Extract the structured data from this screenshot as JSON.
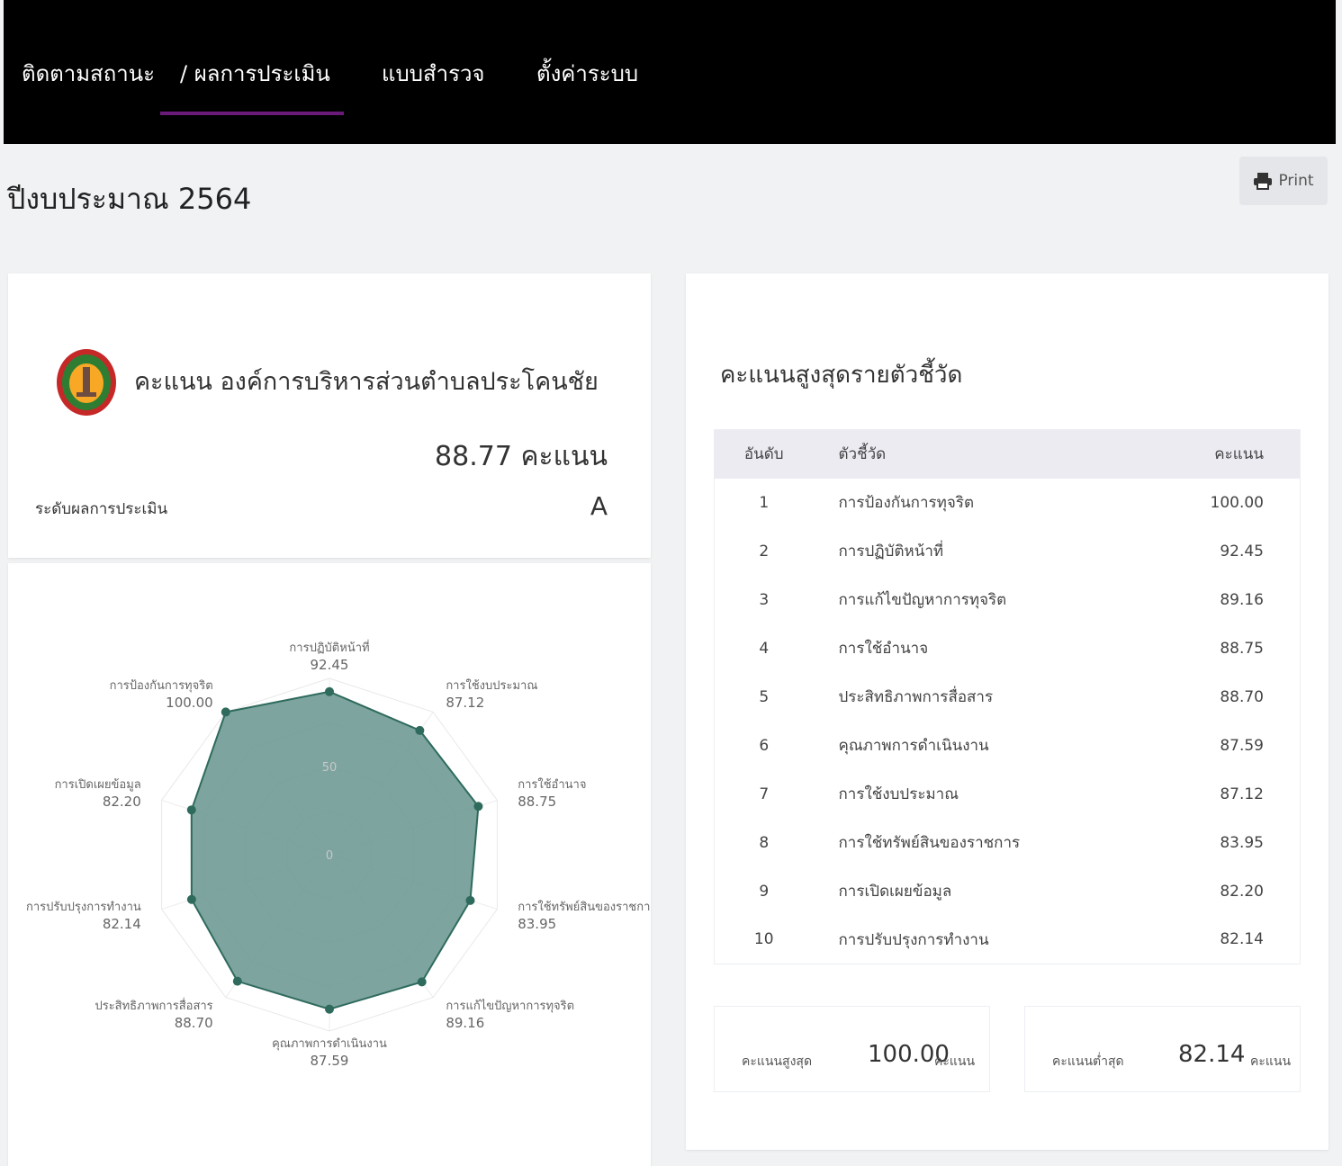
{
  "nav": {
    "items": [
      {
        "label": "ติดตามสถานะ"
      },
      {
        "label": "/ ผลการประเมิน"
      },
      {
        "label": "แบบสำรวจ"
      },
      {
        "label": "ตั้งค่าระบบ"
      }
    ]
  },
  "page": {
    "title": "ปีงบประมาณ 2564",
    "print_label": "Print"
  },
  "summary": {
    "org_title": "คะแนน องค์การบริหารส่วนตำบลประโคนชัย",
    "score_text": "88.77 คะแนน",
    "level_label": "ระดับผลการประเมิน",
    "level_value": "A"
  },
  "ranking": {
    "title": "คะแนนสูงสุดรายตัวชี้วัด",
    "headers": {
      "rank": "อันดับ",
      "indicator": "ตัวชี้วัด",
      "score": "คะแนน"
    },
    "rows": [
      {
        "rank": "1",
        "indicator": "การป้องกันการทุจริต",
        "score": "100.00"
      },
      {
        "rank": "2",
        "indicator": "การปฏิบัติหน้าที่",
        "score": "92.45"
      },
      {
        "rank": "3",
        "indicator": "การแก้ไขปัญหาการทุจริต",
        "score": "89.16"
      },
      {
        "rank": "4",
        "indicator": "การใช้อำนาจ",
        "score": "88.75"
      },
      {
        "rank": "5",
        "indicator": "ประสิทธิภาพการสื่อสาร",
        "score": "88.70"
      },
      {
        "rank": "6",
        "indicator": "คุณภาพการดำเนินงาน",
        "score": "87.59"
      },
      {
        "rank": "7",
        "indicator": "การใช้งบประมาณ",
        "score": "87.12"
      },
      {
        "rank": "8",
        "indicator": "การใช้ทรัพย์สินของราชการ",
        "score": "83.95"
      },
      {
        "rank": "9",
        "indicator": "การเปิดเผยข้อมูล",
        "score": "82.20"
      },
      {
        "rank": "10",
        "indicator": "การปรับปรุงการทำงาน",
        "score": "82.14"
      }
    ],
    "max_label": "คะแนนสูงสุด",
    "max_value": "100.00",
    "max_unit": "คะแนน",
    "min_label": "คะแนนต่ำสุด",
    "min_value": "82.14",
    "min_unit": "คะแนน"
  },
  "colors": {
    "fill": "#6f9a95",
    "stroke": "#2f6b5d",
    "point": "#2f6b5d",
    "accent": "#6a1b7a"
  },
  "chart_data": {
    "type": "radar",
    "range": [
      0,
      100
    ],
    "tick_labels": [
      "0",
      "50"
    ],
    "axes": [
      {
        "label": "การปฏิบัติหน้าที่",
        "value": 92.45,
        "value_label": "92.45"
      },
      {
        "label": "การใช้งบประมาณ",
        "value": 87.12,
        "value_label": "87.12"
      },
      {
        "label": "การใช้อำนาจ",
        "value": 88.75,
        "value_label": "88.75"
      },
      {
        "label": "การใช้ทรัพย์สินของราชการ",
        "value": 83.95,
        "value_label": "83.95"
      },
      {
        "label": "การแก้ไขปัญหาการทุจริต",
        "value": 89.16,
        "value_label": "89.16"
      },
      {
        "label": "คุณภาพการดำเนินงาน",
        "value": 87.59,
        "value_label": "87.59"
      },
      {
        "label": "ประสิทธิภาพการสื่อสาร",
        "value": 88.7,
        "value_label": "88.70"
      },
      {
        "label": "การปรับปรุงการทำงาน",
        "value": 82.14,
        "value_label": "82.14"
      },
      {
        "label": "การเปิดเผยข้อมูล",
        "value": 82.2,
        "value_label": "82.20"
      },
      {
        "label": "การป้องกันการทุจริต",
        "value": 100.0,
        "value_label": "100.00"
      }
    ]
  }
}
